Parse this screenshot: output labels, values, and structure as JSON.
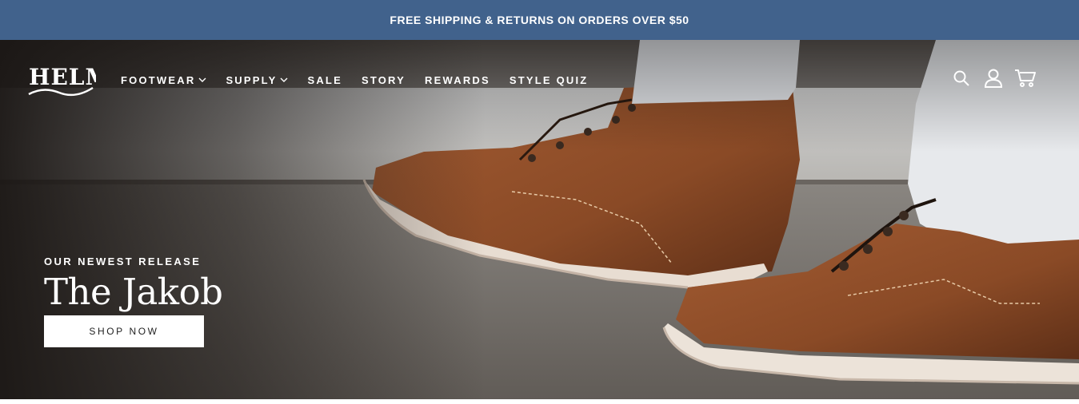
{
  "announcement": {
    "text": "FREE SHIPPING & RETURNS ON ORDERS OVER $50"
  },
  "brand": {
    "logo_text": "HELM"
  },
  "nav": {
    "items": [
      {
        "label": "FOOTWEAR",
        "has_dropdown": true
      },
      {
        "label": "SUPPLY",
        "has_dropdown": true
      },
      {
        "label": "SALE",
        "has_dropdown": false
      },
      {
        "label": "STORY",
        "has_dropdown": false
      },
      {
        "label": "REWARDS",
        "has_dropdown": false
      },
      {
        "label": "STYLE QUIZ",
        "has_dropdown": false
      }
    ]
  },
  "header_icons": [
    "search-icon",
    "account-icon",
    "cart-icon"
  ],
  "hero": {
    "eyebrow": "OUR NEWEST RELEASE",
    "headline": "The Jakob",
    "cta_label": "SHOP NOW"
  },
  "colors": {
    "announcement_bg": "#41628c",
    "leather": "#8a4a26",
    "sole": "#e6d9ce",
    "text_light": "#ffffff"
  }
}
